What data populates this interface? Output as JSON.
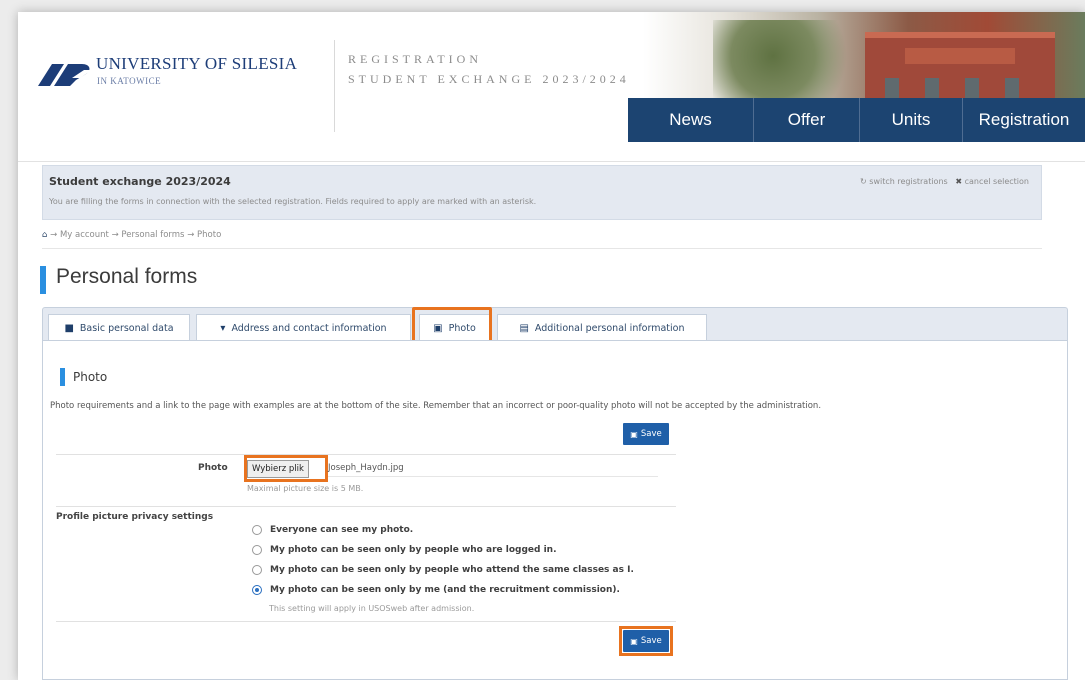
{
  "header": {
    "university_name": "UNIVERSITY OF SILESIA",
    "university_location": "IN KATOWICE",
    "registration_title": "REGISTRATION",
    "registration_subtitle": "STUDENT EXCHANGE 2023/2024",
    "nav": [
      {
        "label": "News"
      },
      {
        "label": "Offer"
      },
      {
        "label": "Units"
      },
      {
        "label": "Registration"
      }
    ]
  },
  "registration_box": {
    "title": "Student exchange 2023/2024",
    "description": "You are filling the forms in connection with the selected registration. Fields required to apply are marked with an asterisk.",
    "switch_label": "switch registrations",
    "cancel_label": "cancel selection"
  },
  "breadcrumb": {
    "home_icon": "home-icon",
    "items": [
      "My account",
      "Personal forms",
      "Photo"
    ]
  },
  "page_title": "Personal forms",
  "tabs": [
    {
      "icon": "user-icon",
      "label": "Basic personal data"
    },
    {
      "icon": "map-marker-icon",
      "label": "Address and contact information"
    },
    {
      "icon": "camera-icon",
      "label": "Photo",
      "active": true
    },
    {
      "icon": "id-card-icon",
      "label": "Additional personal information"
    }
  ],
  "section": {
    "title": "Photo",
    "description": "Photo requirements and a link to the page with examples are at the bottom of the site. Remember that an incorrect or poor-quality photo will not be accepted by the administration."
  },
  "save_label": "Save",
  "photo_field": {
    "label": "Photo",
    "choose_button": "Wybierz plik",
    "file_name": "Joseph_Haydn.jpg",
    "hint": "Maximal picture size is 5 MB."
  },
  "privacy": {
    "label": "Profile picture privacy settings",
    "options": [
      {
        "label": "Everyone can see my photo.",
        "selected": false
      },
      {
        "label": "My photo can be seen only by people who are logged in.",
        "selected": false
      },
      {
        "label": "My photo can be seen only by people who attend the same classes as I.",
        "selected": false
      },
      {
        "label": "My photo can be seen only by me (and the recruitment commission).",
        "selected": true
      }
    ],
    "hint": "This setting will apply in USOSweb after admission."
  },
  "colors": {
    "nav_bg": "#1c4471",
    "accent_blue": "#2a8fe0",
    "highlight_orange": "#e8731f",
    "save_button": "#1f5fa8"
  }
}
